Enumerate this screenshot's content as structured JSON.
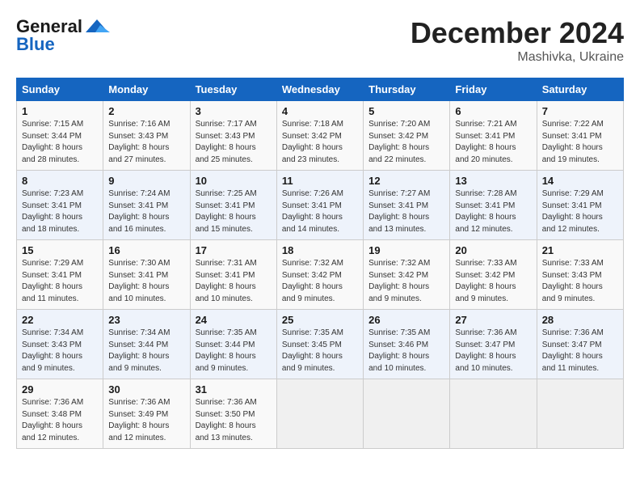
{
  "logo": {
    "line1": "General",
    "line2": "Blue"
  },
  "title": "December 2024",
  "location": "Mashivka, Ukraine",
  "days_of_week": [
    "Sunday",
    "Monday",
    "Tuesday",
    "Wednesday",
    "Thursday",
    "Friday",
    "Saturday"
  ],
  "weeks": [
    [
      {
        "num": "1",
        "sunrise": "7:15 AM",
        "sunset": "3:44 PM",
        "daylight": "8 hours and 28 minutes."
      },
      {
        "num": "2",
        "sunrise": "7:16 AM",
        "sunset": "3:43 PM",
        "daylight": "8 hours and 27 minutes."
      },
      {
        "num": "3",
        "sunrise": "7:17 AM",
        "sunset": "3:43 PM",
        "daylight": "8 hours and 25 minutes."
      },
      {
        "num": "4",
        "sunrise": "7:18 AM",
        "sunset": "3:42 PM",
        "daylight": "8 hours and 23 minutes."
      },
      {
        "num": "5",
        "sunrise": "7:20 AM",
        "sunset": "3:42 PM",
        "daylight": "8 hours and 22 minutes."
      },
      {
        "num": "6",
        "sunrise": "7:21 AM",
        "sunset": "3:41 PM",
        "daylight": "8 hours and 20 minutes."
      },
      {
        "num": "7",
        "sunrise": "7:22 AM",
        "sunset": "3:41 PM",
        "daylight": "8 hours and 19 minutes."
      }
    ],
    [
      {
        "num": "8",
        "sunrise": "7:23 AM",
        "sunset": "3:41 PM",
        "daylight": "8 hours and 18 minutes."
      },
      {
        "num": "9",
        "sunrise": "7:24 AM",
        "sunset": "3:41 PM",
        "daylight": "8 hours and 16 minutes."
      },
      {
        "num": "10",
        "sunrise": "7:25 AM",
        "sunset": "3:41 PM",
        "daylight": "8 hours and 15 minutes."
      },
      {
        "num": "11",
        "sunrise": "7:26 AM",
        "sunset": "3:41 PM",
        "daylight": "8 hours and 14 minutes."
      },
      {
        "num": "12",
        "sunrise": "7:27 AM",
        "sunset": "3:41 PM",
        "daylight": "8 hours and 13 minutes."
      },
      {
        "num": "13",
        "sunrise": "7:28 AM",
        "sunset": "3:41 PM",
        "daylight": "8 hours and 12 minutes."
      },
      {
        "num": "14",
        "sunrise": "7:29 AM",
        "sunset": "3:41 PM",
        "daylight": "8 hours and 12 minutes."
      }
    ],
    [
      {
        "num": "15",
        "sunrise": "7:29 AM",
        "sunset": "3:41 PM",
        "daylight": "8 hours and 11 minutes."
      },
      {
        "num": "16",
        "sunrise": "7:30 AM",
        "sunset": "3:41 PM",
        "daylight": "8 hours and 10 minutes."
      },
      {
        "num": "17",
        "sunrise": "7:31 AM",
        "sunset": "3:41 PM",
        "daylight": "8 hours and 10 minutes."
      },
      {
        "num": "18",
        "sunrise": "7:32 AM",
        "sunset": "3:42 PM",
        "daylight": "8 hours and 9 minutes."
      },
      {
        "num": "19",
        "sunrise": "7:32 AM",
        "sunset": "3:42 PM",
        "daylight": "8 hours and 9 minutes."
      },
      {
        "num": "20",
        "sunrise": "7:33 AM",
        "sunset": "3:42 PM",
        "daylight": "8 hours and 9 minutes."
      },
      {
        "num": "21",
        "sunrise": "7:33 AM",
        "sunset": "3:43 PM",
        "daylight": "8 hours and 9 minutes."
      }
    ],
    [
      {
        "num": "22",
        "sunrise": "7:34 AM",
        "sunset": "3:43 PM",
        "daylight": "8 hours and 9 minutes."
      },
      {
        "num": "23",
        "sunrise": "7:34 AM",
        "sunset": "3:44 PM",
        "daylight": "8 hours and 9 minutes."
      },
      {
        "num": "24",
        "sunrise": "7:35 AM",
        "sunset": "3:44 PM",
        "daylight": "8 hours and 9 minutes."
      },
      {
        "num": "25",
        "sunrise": "7:35 AM",
        "sunset": "3:45 PM",
        "daylight": "8 hours and 9 minutes."
      },
      {
        "num": "26",
        "sunrise": "7:35 AM",
        "sunset": "3:46 PM",
        "daylight": "8 hours and 10 minutes."
      },
      {
        "num": "27",
        "sunrise": "7:36 AM",
        "sunset": "3:47 PM",
        "daylight": "8 hours and 10 minutes."
      },
      {
        "num": "28",
        "sunrise": "7:36 AM",
        "sunset": "3:47 PM",
        "daylight": "8 hours and 11 minutes."
      }
    ],
    [
      {
        "num": "29",
        "sunrise": "7:36 AM",
        "sunset": "3:48 PM",
        "daylight": "8 hours and 12 minutes."
      },
      {
        "num": "30",
        "sunrise": "7:36 AM",
        "sunset": "3:49 PM",
        "daylight": "8 hours and 12 minutes."
      },
      {
        "num": "31",
        "sunrise": "7:36 AM",
        "sunset": "3:50 PM",
        "daylight": "8 hours and 13 minutes."
      },
      null,
      null,
      null,
      null
    ]
  ]
}
